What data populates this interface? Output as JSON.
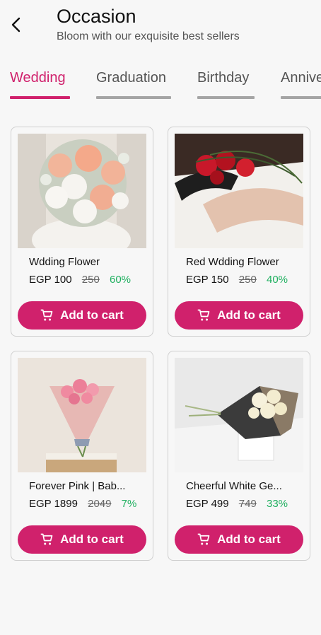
{
  "header": {
    "title": "Occasion",
    "subtitle": "Bloom with our exquisite best sellers"
  },
  "tabs": [
    {
      "label": "Wedding",
      "active": true
    },
    {
      "label": "Graduation",
      "active": false
    },
    {
      "label": "Birthday",
      "active": false
    },
    {
      "label": "Anniversary",
      "active": false
    }
  ],
  "products": [
    {
      "name": "Wdding Flower",
      "price": "EGP 100",
      "old_price": "250",
      "discount": "60%",
      "button": "Add to cart"
    },
    {
      "name": "Red Wdding Flower",
      "price": "EGP 150",
      "old_price": "250",
      "discount": "40%",
      "button": "Add to cart"
    },
    {
      "name": "Forever Pink | Bab...",
      "price": "EGP 1899",
      "old_price": "2049",
      "discount": "7%",
      "button": "Add to cart"
    },
    {
      "name": "Cheerful White Ge...",
      "price": "EGP 499",
      "old_price": "749",
      "discount": "33%",
      "button": "Add to cart"
    }
  ],
  "colors": {
    "accent": "#d0216c",
    "discount": "#20b060",
    "background": "#f7f7f7"
  },
  "icons": {
    "back": "arrow-back-icon",
    "cart": "cart-icon"
  }
}
